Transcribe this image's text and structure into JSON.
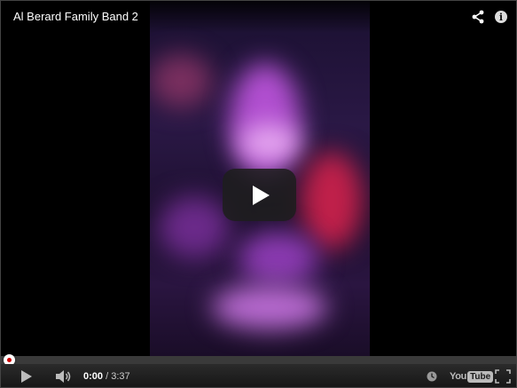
{
  "video": {
    "title": "Al Berard Family Band 2"
  },
  "top_controls": {
    "share_icon": "share-icon",
    "info_icon": "info-icon",
    "info_glyph": "i"
  },
  "playback": {
    "current_time": "0:00",
    "separator": " / ",
    "duration": "3:37",
    "progress": 0
  },
  "controls": {
    "play_icon": "play-icon",
    "volume_icon": "volume-icon",
    "watch_later_icon": "clock-icon",
    "fullscreen_icon": "fullscreen-icon"
  },
  "branding": {
    "logo_you": "You",
    "logo_tube": "Tube",
    "colors": {
      "accent": "#cc0000",
      "control_bg": "#1b1b1b",
      "text": "#ffffff"
    }
  }
}
